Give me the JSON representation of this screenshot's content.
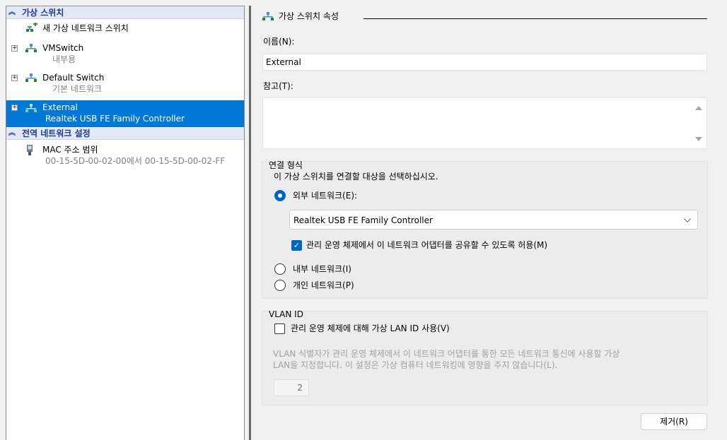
{
  "tree": {
    "section_virtual_switches": "가상 스위치",
    "new_switch": "새 가상 네트워크 스위치",
    "switches": [
      {
        "name": "VMSwitch",
        "type": "내부용"
      },
      {
        "name": "Default Switch",
        "type": "기본 네트워크"
      },
      {
        "name": "External",
        "type": "Realtek USB FE Family Controller"
      }
    ],
    "section_global": "전역 네트워크 설정",
    "mac_range": {
      "label": "MAC 주소 범위",
      "value": "00-15-5D-00-02-00에서 00-15-5D-00-02-FF"
    }
  },
  "properties": {
    "group_title": "가상 스위치 속성",
    "name_label": "이름(N):",
    "name_value": "External",
    "notes_label": "참고(T):",
    "notes_value": "",
    "connection": {
      "title": "연결 형식",
      "prompt": "이 가상 스위치를 연결할 대상을 선택하십시오.",
      "external_label": "외부 네트워크(E):",
      "adapter_selected": "Realtek USB FE Family Controller",
      "share_label": "관리 운영 체제에서 이 네트워크 어댑터를 공유할 수 있도록 허용(M)",
      "internal_label": "내부 네트워크(I)",
      "private_label": "개인 네트워크(P)",
      "selected_type": "external",
      "share_checked": true
    },
    "vlan": {
      "title": "VLAN ID",
      "enable_label": "관리 운영 체제에 대해 가상 LAN ID 사용(V)",
      "enabled": false,
      "description_line1": "VLAN 식별자가 관리 운영 체제에서 이 네트워크 어댑터를 통한 모든 네트워크 통신에 사용할 가상",
      "description_line2": "LAN을 지정합니다. 이 설정은 가상 컴퓨터 네트워킹에 영향을 주지 않습니다(L).",
      "id_value": "2"
    },
    "remove_button": "제거(R)"
  },
  "colors": {
    "selection": "#0078d7",
    "accent": "#0067c0",
    "section_header_text": "#1c3a8f"
  },
  "icons": [
    "collapse-chevron-icon",
    "add-switch-icon",
    "network-switch-icon",
    "expand-plus-icon",
    "mac-address-icon",
    "dropdown-chevron-icon"
  ]
}
